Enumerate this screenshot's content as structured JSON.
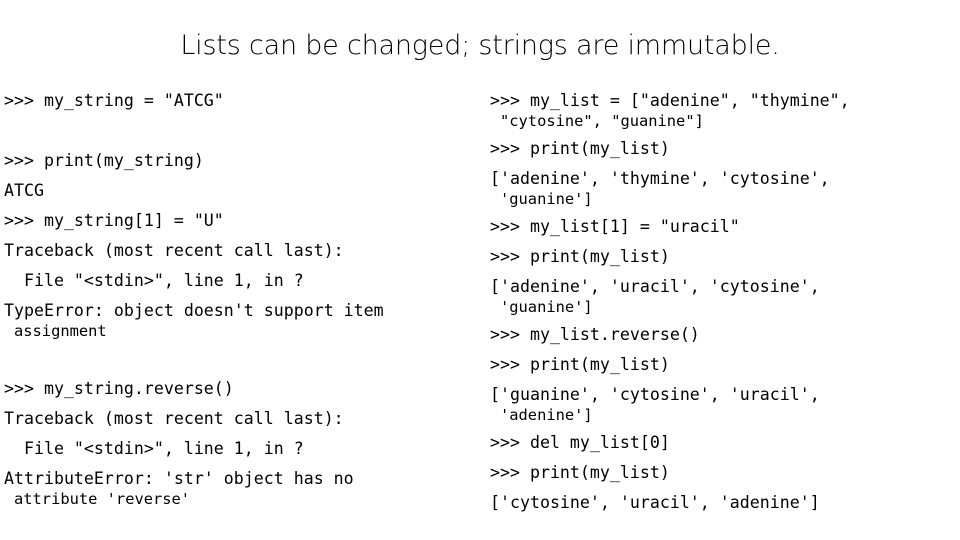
{
  "slide": {
    "title": "Lists can be changed; strings are immutable.",
    "background_color": "#ffffff",
    "text_color": "#000000"
  },
  "left_column": {
    "name": "string-immutability-session",
    "lines": [
      {
        "text": "&gt;&gt;&gt; my_string = \"ATCG\"",
        "kind": "input"
      },
      {
        "text": "",
        "kind": "blank"
      },
      {
        "text": "&gt;&gt;&gt; print(my_string)",
        "kind": "input"
      },
      {
        "text": "ATCG",
        "kind": "output"
      },
      {
        "text": "&gt;&gt;&gt; my_string[1] = \"U\"",
        "kind": "input"
      },
      {
        "text": "Traceback (most recent call last):",
        "kind": "output"
      },
      {
        "text": "  File \"&lt;stdin&gt;\", line 1, in ?",
        "kind": "output"
      },
      {
        "text": "TypeError: object doesn't support item",
        "cont": "assignment",
        "kind": "error"
      },
      {
        "text": "",
        "kind": "blank"
      },
      {
        "text": "&gt;&gt;&gt; my_string.reverse()",
        "kind": "input"
      },
      {
        "text": "Traceback (most recent call last):",
        "kind": "output"
      },
      {
        "text": "  File \"&lt;stdin&gt;\", line 1, in ?",
        "kind": "output"
      },
      {
        "text": "AttributeError: 'str' object has no",
        "cont": "attribute 'reverse'",
        "kind": "error"
      }
    ]
  },
  "right_column": {
    "name": "list-mutability-session",
    "lines": [
      {
        "text": "&gt;&gt;&gt; my_list = [\"adenine\", \"thymine\",",
        "cont": "\"cytosine\", \"guanine\"]",
        "kind": "input"
      },
      {
        "text": "&gt;&gt;&gt; print(my_list)",
        "kind": "input"
      },
      {
        "text": "['adenine', 'thymine', 'cytosine',",
        "cont": "'guanine']",
        "kind": "output"
      },
      {
        "text": "&gt;&gt;&gt; my_list[1] = \"uracil\"",
        "kind": "input"
      },
      {
        "text": "&gt;&gt;&gt; print(my_list)",
        "kind": "input"
      },
      {
        "text": "['adenine', 'uracil', 'cytosine',",
        "cont": "'guanine']",
        "kind": "output"
      },
      {
        "text": "&gt;&gt;&gt; my_list.reverse()",
        "kind": "input"
      },
      {
        "text": "&gt;&gt;&gt; print(my_list)",
        "kind": "input"
      },
      {
        "text": "['guanine', 'cytosine', 'uracil',",
        "cont": "'adenine']",
        "kind": "output"
      },
      {
        "text": "&gt;&gt;&gt; del my_list[0]",
        "kind": "input"
      },
      {
        "text": "&gt;&gt;&gt; print(my_list)",
        "kind": "input"
      },
      {
        "text": "['cytosine', 'uracil', 'adenine']",
        "kind": "output"
      }
    ]
  }
}
